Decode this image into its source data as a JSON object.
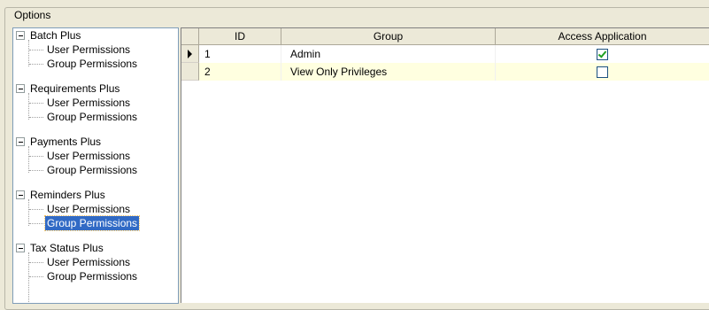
{
  "groupbox": {
    "title": "Options"
  },
  "tree": {
    "nodes": [
      {
        "label": "Batch Plus",
        "level": 0
      },
      {
        "label": "User Permissions",
        "level": 1
      },
      {
        "label": "Group Permissions",
        "level": 1
      },
      {
        "label": "Requirements Plus",
        "level": 0
      },
      {
        "label": "User Permissions",
        "level": 1
      },
      {
        "label": "Group Permissions",
        "level": 1
      },
      {
        "label": "Payments Plus",
        "level": 0
      },
      {
        "label": "User Permissions",
        "level": 1
      },
      {
        "label": "Group Permissions",
        "level": 1
      },
      {
        "label": "Reminders Plus",
        "level": 0
      },
      {
        "label": "User Permissions",
        "level": 1
      },
      {
        "label": "Group Permissions",
        "level": 1,
        "selected": true
      },
      {
        "label": "Tax Status Plus",
        "level": 0
      },
      {
        "label": "User Permissions",
        "level": 1
      },
      {
        "label": "Group Permissions",
        "level": 1
      }
    ]
  },
  "grid": {
    "columns": [
      "ID",
      "Group",
      "Access Application"
    ],
    "rows": [
      {
        "id": "1",
        "group": "Admin",
        "access": true,
        "current": true
      },
      {
        "id": "2",
        "group": "View Only Privileges",
        "access": false,
        "current": false
      }
    ]
  }
}
